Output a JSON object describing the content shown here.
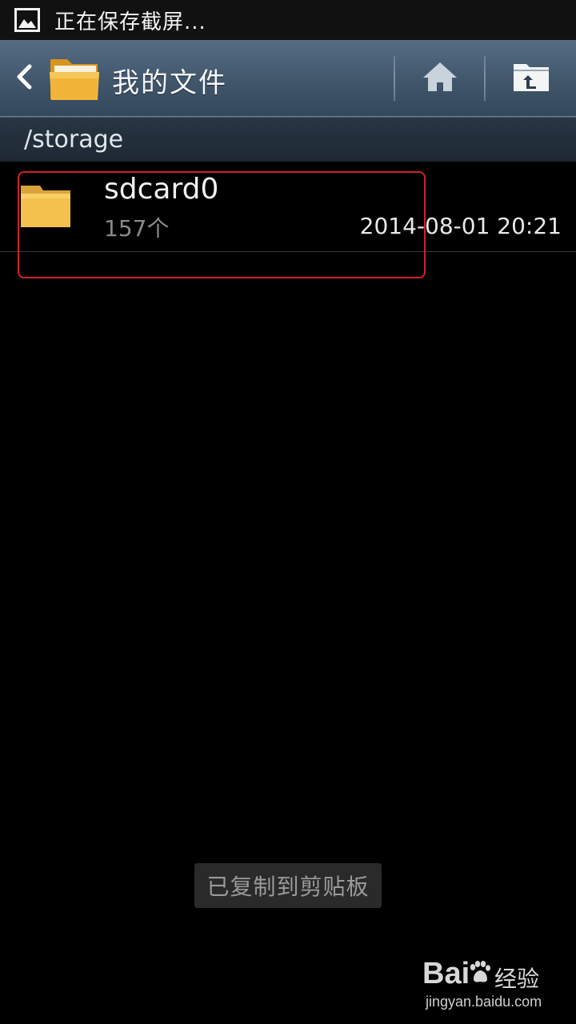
{
  "status_bar": {
    "text": "正在保存截屏...",
    "icon": "image-icon"
  },
  "action_bar": {
    "title": "我的文件",
    "back_icon": "chevron-left-icon",
    "app_icon": "folder-icon",
    "home_icon": "home-icon",
    "up_icon": "folder-up-icon"
  },
  "path_bar": {
    "path": "/storage"
  },
  "files": [
    {
      "name": "sdcard0",
      "count": "157个",
      "date": "2014-08-01 20:21",
      "icon": "folder-icon"
    }
  ],
  "toast": {
    "text": "已复制到剪贴板"
  },
  "watermark": {
    "brand": "Bai",
    "brand_cn": "经验",
    "url": "jingyan.baidu.com"
  },
  "colors": {
    "action_bar": "#41566b",
    "folder": "#f2b53a",
    "highlight": "#d0202c"
  }
}
